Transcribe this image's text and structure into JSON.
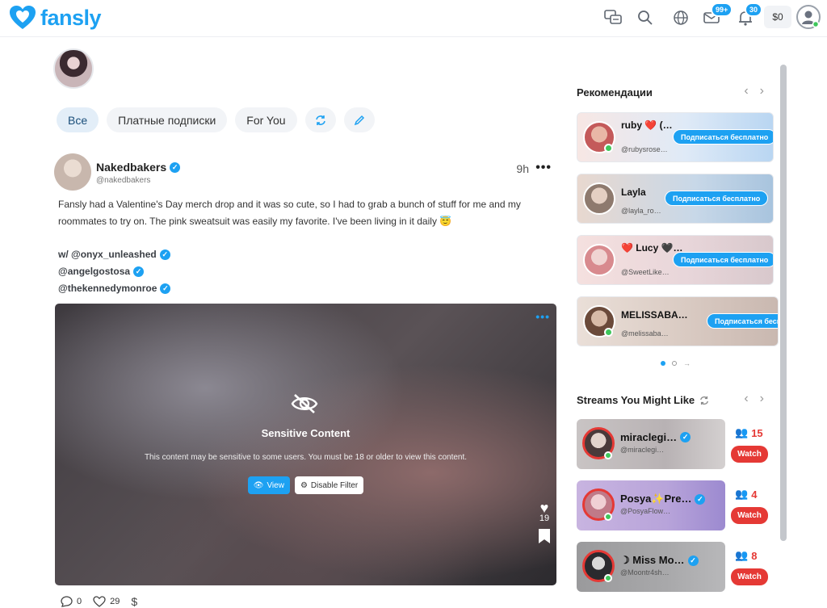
{
  "brand": {
    "name": "fansly",
    "color": "#1da1f2"
  },
  "topbar": {
    "icons": [
      "chat-icon",
      "search-icon",
      "globe-icon",
      "messages-icon",
      "notifications-icon"
    ],
    "messages_badge": "99+",
    "notifications_badge": "30",
    "wallet": "$0"
  },
  "tabs": [
    "Все",
    "Платные подписки",
    "For You"
  ],
  "post": {
    "author": "Nakedbakers",
    "handle": "@nakedbakers",
    "time": "9h",
    "text": "Fansly had a Valentine's Day merch drop and it was so cute, so I had to grab a bunch of stuff for me and my roommates to try on. The pink sweatsuit was easily my favorite. I've been living in it daily 😇",
    "mentions": [
      "w/ @onyx_unleashed",
      "@angelgostosa",
      "@thekennedymonroe"
    ],
    "media": {
      "title": "Sensitive Content",
      "description": "This content may be sensitive to some users. You must be 18 or older to view this content.",
      "view_label": "View",
      "filter_label": "Disable Filter",
      "likes": "19"
    },
    "actions": {
      "comments": "0",
      "likes": "29"
    }
  },
  "recommendations": {
    "title": "Рекомендации",
    "subscribe_label": "Подписаться бесплатно",
    "items": [
      {
        "name": "ruby ❤️ (…",
        "handle": "@rubysrose…"
      },
      {
        "name": "Layla",
        "handle": "@layla_ro…"
      },
      {
        "name": "❤️ Lucy 🖤…",
        "handle": "@SweetLike…"
      },
      {
        "name": "MELISSABA…",
        "handle": "@melissaba…"
      }
    ]
  },
  "streams": {
    "title": "Streams You Might Like",
    "watch_label": "Watch",
    "items": [
      {
        "name": "miraclegi…",
        "handle": "@miraclegi…",
        "viewers": "15"
      },
      {
        "name": "Posya✨Pre…",
        "handle": "@PosyaFlow…",
        "viewers": "4"
      },
      {
        "name": "☽ Miss Mo…",
        "handle": "@Moontr4sh…",
        "viewers": "8"
      }
    ]
  }
}
